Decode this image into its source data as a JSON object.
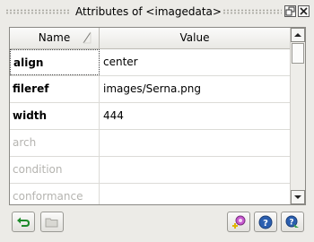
{
  "window": {
    "title": "Attributes of <imagedata>"
  },
  "table": {
    "columns": [
      "Name",
      "Value"
    ],
    "rows": [
      {
        "name": "align",
        "value": "center",
        "state": "set"
      },
      {
        "name": "fileref",
        "value": "images/Serna.png",
        "state": "set"
      },
      {
        "name": "width",
        "value": "444",
        "state": "set"
      },
      {
        "name": "arch",
        "value": "",
        "state": "unset"
      },
      {
        "name": "condition",
        "value": "",
        "state": "unset"
      },
      {
        "name": "conformance",
        "value": "",
        "state": "unset"
      }
    ]
  },
  "icons": {
    "float": "float-window-icon",
    "close": "close-icon",
    "sort": "sort-indicator-icon",
    "scroll_up": "arrow-up-icon",
    "scroll_down": "arrow-down-icon",
    "undo": "undo-icon",
    "folder": "folder-icon",
    "add_namespace": "add-namespace-icon",
    "help": "help-icon",
    "whats_this": "whats-this-icon"
  },
  "colors": {
    "window_bg": "#ecebe7",
    "unset_text": "#b5b4b0",
    "accent_blue": "#2b5fb0"
  }
}
